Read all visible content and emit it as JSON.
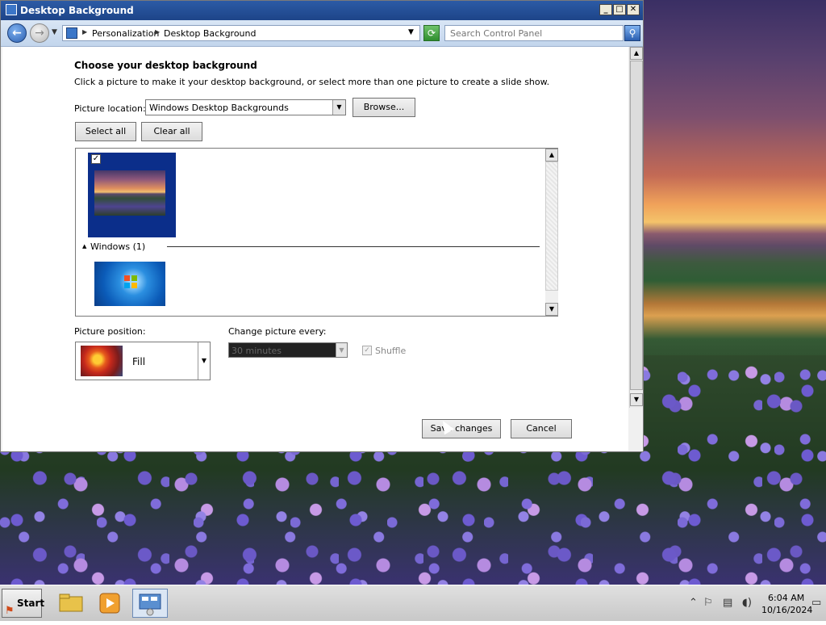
{
  "window": {
    "title": "Desktop Background",
    "controls": {
      "minimize": "_",
      "maximize": "□",
      "close": "✕"
    }
  },
  "address_bar": {
    "breadcrumbs": [
      "Personalization",
      "Desktop Background"
    ],
    "search_placeholder": "Search Control Panel"
  },
  "content": {
    "heading": "Choose your desktop background",
    "subtext": "Click a picture to make it your desktop background, or select more than one picture to create a slide show.",
    "picture_location": {
      "label": "Picture location:",
      "value": "Windows Desktop Backgrounds"
    },
    "browse_label": "Browse...",
    "select_all_label": "Select all",
    "clear_all_label": "Clear all",
    "picture_list": {
      "selected_check": "✓",
      "group": {
        "label": "Windows (1)"
      }
    },
    "picture_position": {
      "label": "Picture position:",
      "value": "Fill"
    },
    "change_picture": {
      "label": "Change picture every:",
      "value": "30 minutes"
    },
    "shuffle": {
      "label": "Shuffle",
      "check": "✓"
    }
  },
  "footer": {
    "save_label": "Save changes",
    "cancel_label": "Cancel"
  },
  "taskbar": {
    "start_label": "Start",
    "time": "6:04 AM",
    "date": "10/16/2024"
  },
  "colors": {
    "titlebar": "#2c5ba6",
    "selected_tile": "#0b2e8a"
  },
  "icons": [
    "control-panel-icon",
    "back-arrow-icon",
    "forward-arrow-icon",
    "refresh-icon",
    "search-icon",
    "checkbox-icon",
    "windows-logo-icon",
    "folder-icon",
    "media-player-icon",
    "control-panel-app-icon",
    "flag-icon",
    "network-icon",
    "volume-icon",
    "show-desktop-icon"
  ]
}
